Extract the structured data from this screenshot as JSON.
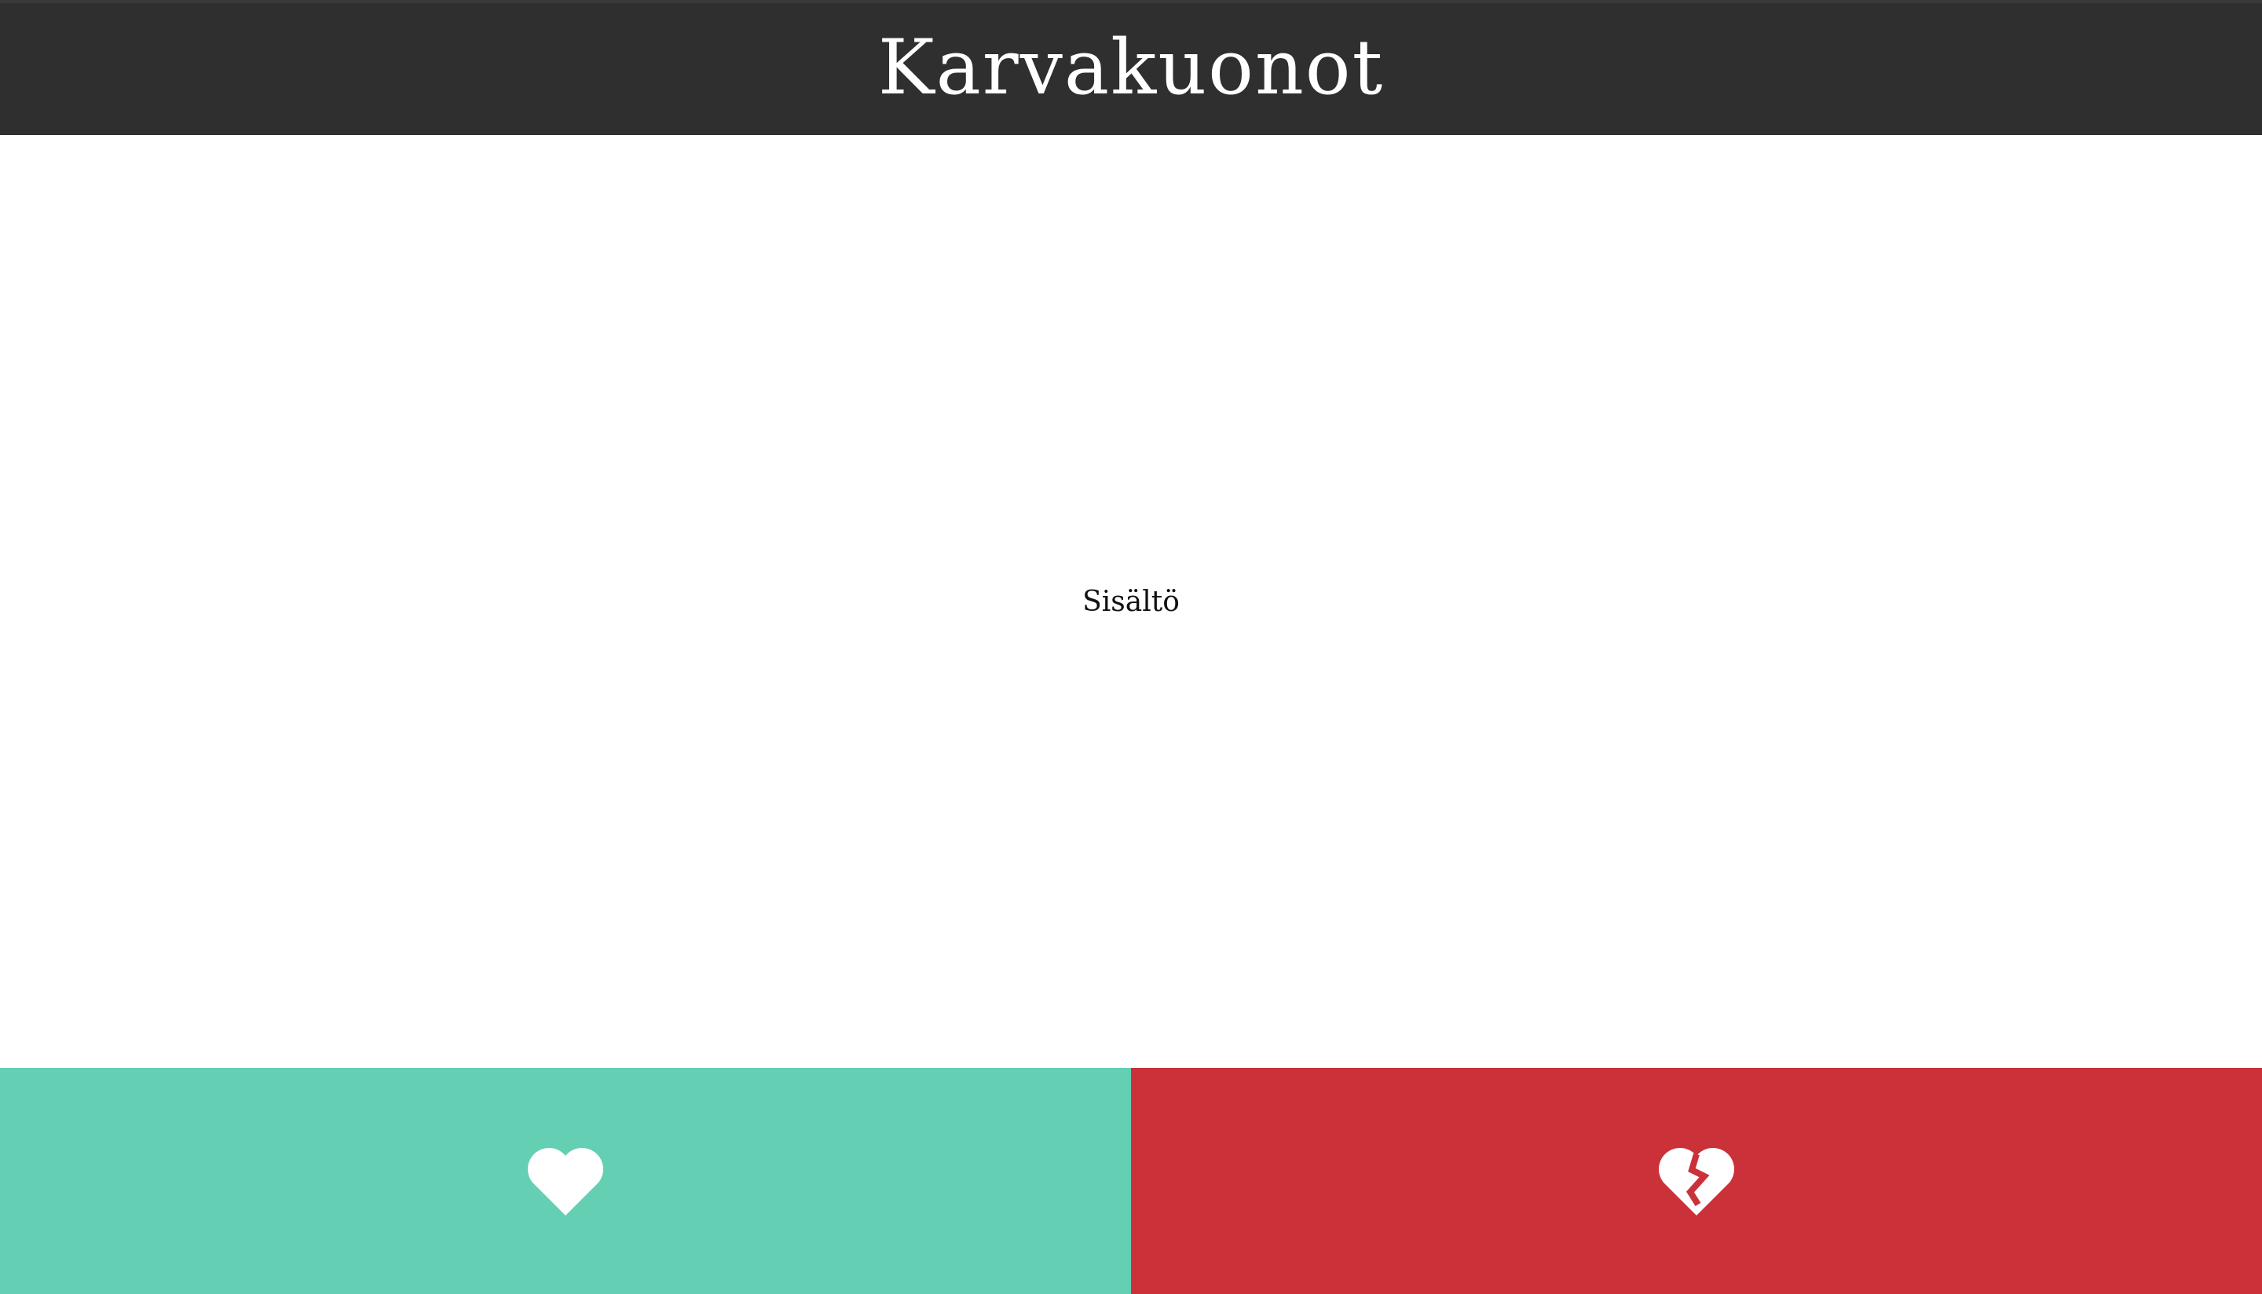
{
  "header": {
    "title": "Karvakuonot"
  },
  "main": {
    "content_text": "Sisältö"
  },
  "actions": {
    "like": {
      "icon": "heart-icon",
      "color": "#65cfb4"
    },
    "dislike": {
      "icon": "broken-heart-icon",
      "color": "#cb3139"
    }
  },
  "colors": {
    "header_bg": "#2f2f2f",
    "page_bg": "#ffffff"
  }
}
